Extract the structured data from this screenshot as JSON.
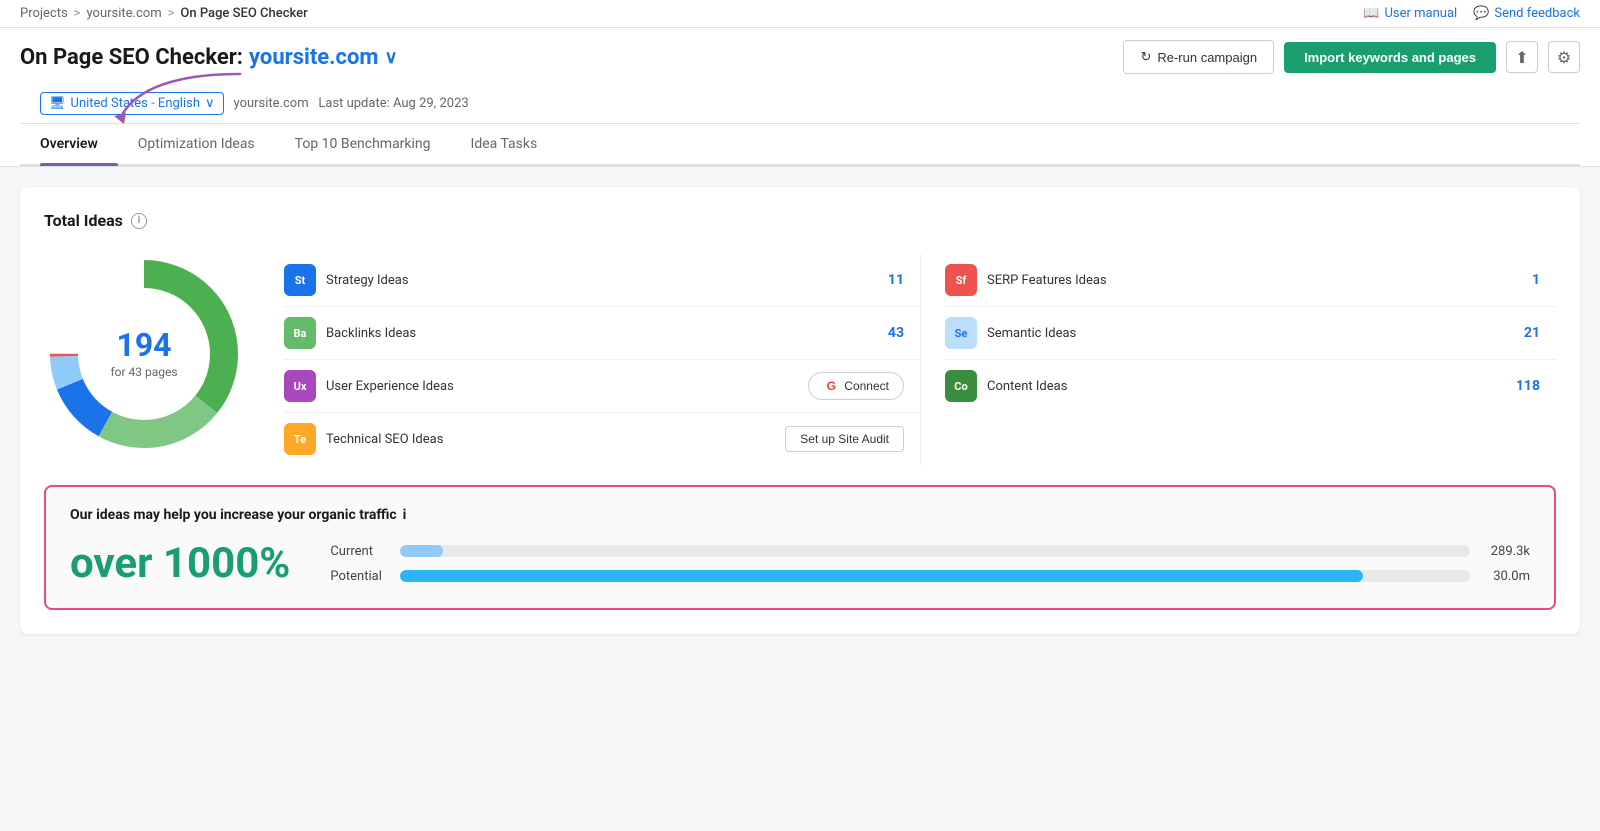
{
  "breadcrumb": {
    "projects": "Projects",
    "sep1": ">",
    "site": "yoursite.com",
    "sep2": ">",
    "current": "On Page SEO Checker"
  },
  "topnav": {
    "user_manual": "User manual",
    "send_feedback": "Send feedback"
  },
  "header": {
    "title_prefix": "On Page SEO Checker:",
    "domain": "yoursite.com",
    "rerun_label": "Re-run campaign",
    "import_label": "Import keywords and pages"
  },
  "subheader": {
    "locale": "United States - English",
    "site": "yoursite.com",
    "last_update": "Last update: Aug 29, 2023"
  },
  "tabs": [
    {
      "label": "Overview",
      "active": true
    },
    {
      "label": "Optimization Ideas",
      "active": false
    },
    {
      "label": "Top 10 Benchmarking",
      "active": false
    },
    {
      "label": "Idea Tasks",
      "active": false
    }
  ],
  "total_ideas": {
    "title": "Total Ideas",
    "total": "194",
    "pages": "for 43 pages"
  },
  "chart": {
    "segments": [
      {
        "color": "#4caf50",
        "value": 118,
        "percent": 60.8
      },
      {
        "color": "#81c784",
        "value": 43,
        "percent": 22.2
      },
      {
        "color": "#1a73e8",
        "value": 21,
        "percent": 10.8
      },
      {
        "color": "#90caf9",
        "value": 11,
        "percent": 5.7
      },
      {
        "color": "#ef5350",
        "value": 1,
        "percent": 0.5
      }
    ]
  },
  "ideas_left": [
    {
      "badge_text": "St",
      "badge_color": "#1a73e8",
      "name": "Strategy Ideas",
      "count": "11"
    },
    {
      "badge_text": "Ba",
      "badge_color": "#66bb6a",
      "name": "Backlinks Ideas",
      "count": "43"
    },
    {
      "badge_text": "Ux",
      "badge_color": "#ab47bc",
      "name": "User Experience Ideas",
      "count": null,
      "action": "connect"
    },
    {
      "badge_text": "Te",
      "badge_color": "#ffa726",
      "name": "Technical SEO Ideas",
      "count": null,
      "action": "site_audit"
    }
  ],
  "ideas_right": [
    {
      "badge_text": "Sf",
      "badge_color": "#ef5350",
      "name": "SERP Features Ideas",
      "count": "1"
    },
    {
      "badge_text": "Se",
      "badge_color": "#90caf9",
      "badge_text_color": "#1a73e8",
      "name": "Semantic Ideas",
      "count": "21"
    },
    {
      "badge_text": "Co",
      "badge_color": "#388e3c",
      "name": "Content Ideas",
      "count": "118"
    }
  ],
  "buttons": {
    "connect": "Connect",
    "set_up_site_audit": "Set up Site Audit"
  },
  "traffic": {
    "title": "Our ideas may help you increase your organic traffic",
    "percent": "over 1000%",
    "current_label": "Current",
    "current_value": "289.3k",
    "potential_label": "Potential",
    "potential_value": "30.0m",
    "current_fill_pct": 4,
    "potential_fill_pct": 90
  }
}
